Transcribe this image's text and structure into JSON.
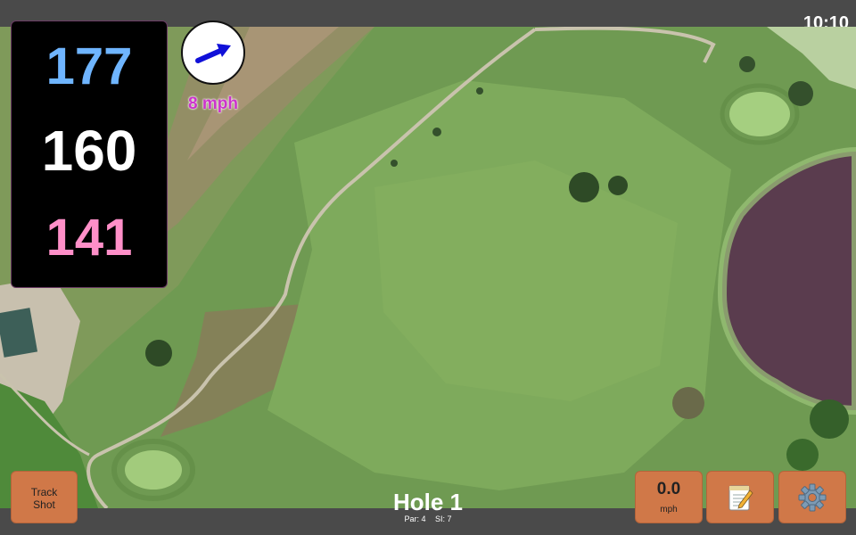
{
  "status_bar": {
    "time": "10:10"
  },
  "distances": {
    "back": "177",
    "middle": "160",
    "front": "141",
    "back_color": "#6fb5ff",
    "middle_color": "#ffffff",
    "front_color": "#ff8fc8"
  },
  "wind": {
    "speed_label": "8 mph",
    "arrow_color": "#1010d8",
    "label_color": "#cc33cc"
  },
  "track_shot": {
    "label_line1": "Track",
    "label_line2": "Shot"
  },
  "speed_button": {
    "value": "0.0",
    "unit": "mph"
  },
  "notes_button": {
    "icon": "notepad-icon"
  },
  "settings_button": {
    "icon": "gear-icon"
  },
  "hole": {
    "title": "Hole 1",
    "par": "Par: 4",
    "stroke_index": "SI: 7"
  },
  "colors": {
    "button_accent": "#d07848",
    "bar": "#4a4a4a"
  }
}
